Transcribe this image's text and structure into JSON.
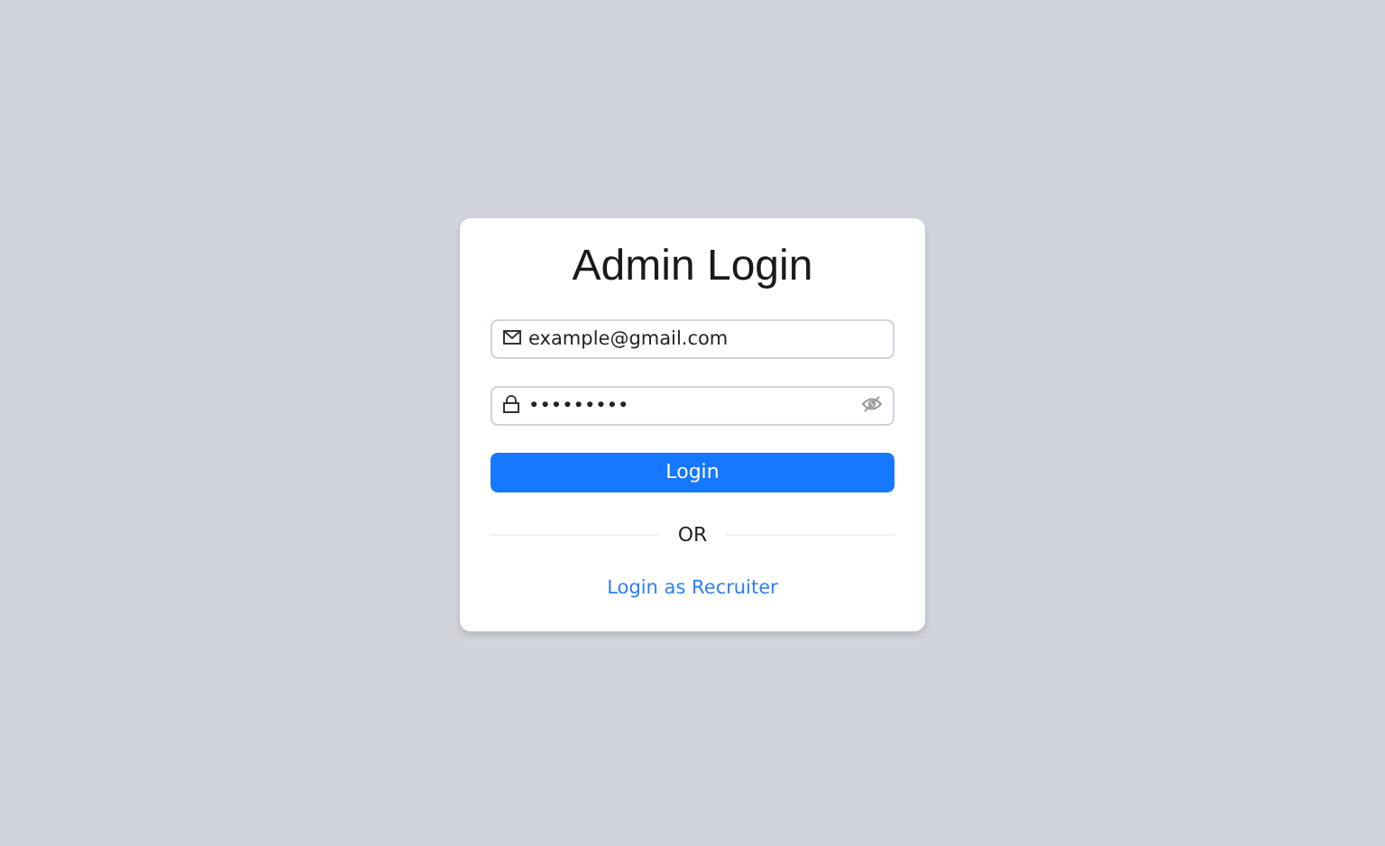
{
  "title": "Admin Login",
  "email_field": {
    "value": "example@gmail.com"
  },
  "password_field": {
    "value": "•••••••••",
    "reveal": false
  },
  "login_button": "Login",
  "divider_text": "OR",
  "recruiter_link": "Login as Recruiter"
}
